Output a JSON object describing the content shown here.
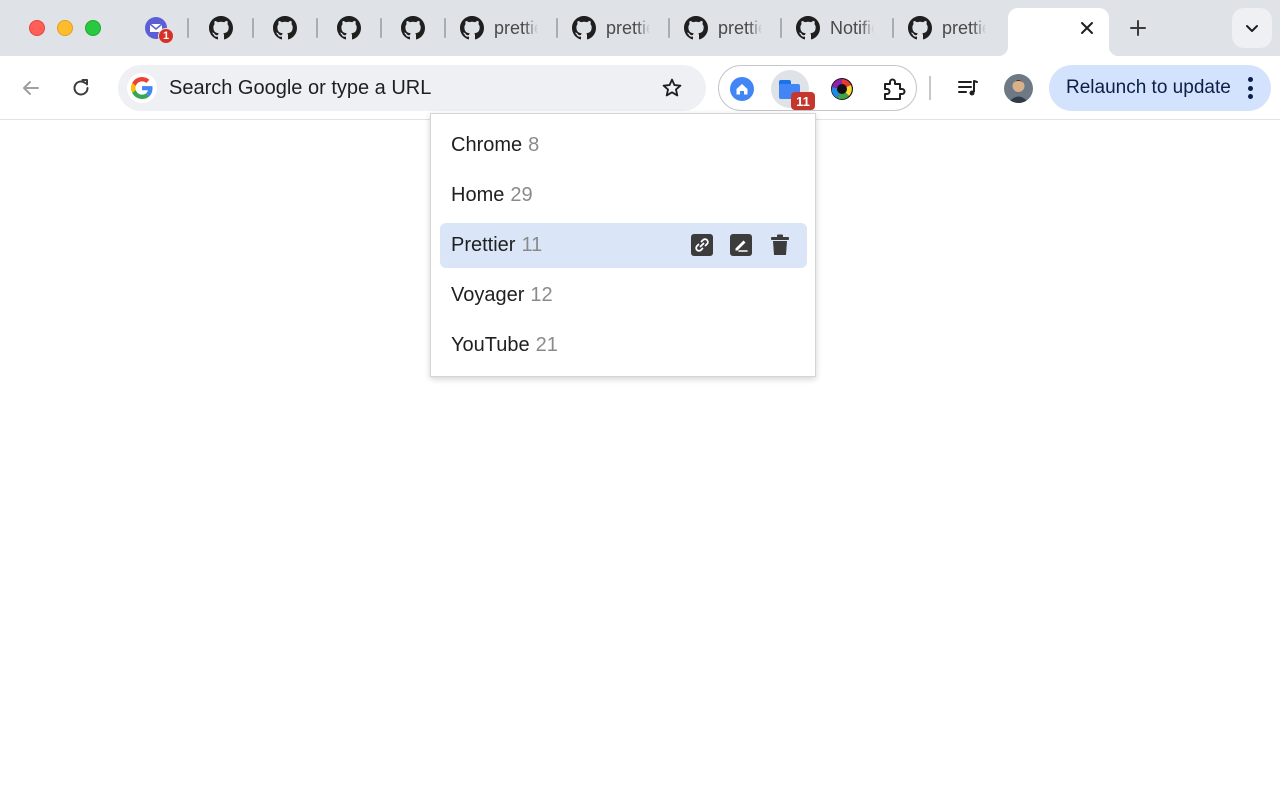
{
  "window": {
    "traffic_lights": [
      "close",
      "minimize",
      "zoom"
    ]
  },
  "tabs": [
    {
      "title": "",
      "icon": "mail-icon",
      "badge": "1"
    },
    {
      "title": "",
      "icon": "github-icon"
    },
    {
      "title": "",
      "icon": "github-icon"
    },
    {
      "title": "",
      "icon": "github-icon"
    },
    {
      "title": "",
      "icon": "github-icon"
    },
    {
      "title": "prettier",
      "icon": "github-icon"
    },
    {
      "title": "prettier",
      "icon": "github-icon"
    },
    {
      "title": "prettier",
      "icon": "github-icon"
    },
    {
      "title": "Notifications",
      "icon": "github-icon"
    },
    {
      "title": "prettier",
      "icon": "github-icon"
    }
  ],
  "omnibox": {
    "placeholder": "Search Google or type a URL"
  },
  "extensions": {
    "tab_groups_badge": "11"
  },
  "toolbar": {
    "relaunch_label": "Relaunch to update"
  },
  "dropdown": {
    "items": [
      {
        "name": "Chrome",
        "count": "8"
      },
      {
        "name": "Home",
        "count": "29"
      },
      {
        "name": "Prettier",
        "count": "11",
        "selected": true
      },
      {
        "name": "Voyager",
        "count": "12"
      },
      {
        "name": "YouTube",
        "count": "21"
      }
    ]
  },
  "colors": {
    "tabstrip_bg": "#dfe2e7",
    "relaunch_bg": "#d3e3fd",
    "selected_item_bg": "#dbe5f8",
    "badge_red": "#c5372c"
  }
}
